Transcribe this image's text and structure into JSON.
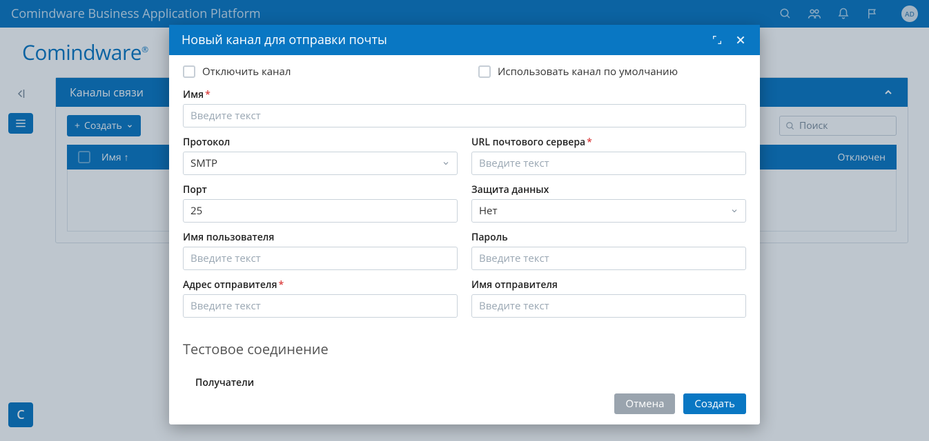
{
  "header": {
    "title": "Comindware Business Application Platform",
    "avatar": "AD"
  },
  "brand": "Comindware",
  "page": {
    "title": "Каналы связи",
    "create": "Создать",
    "search_placeholder": "Поиск",
    "cols": {
      "name": "Имя",
      "disabled": "Отключен"
    }
  },
  "modal": {
    "title": "Новый канал для отправки почты",
    "disable_channel": "Отключить канал",
    "use_default": "Использовать канал по умолчанию",
    "labels": {
      "name": "Имя",
      "protocol": "Протокол",
      "url": "URL почтового сервера",
      "port": "Порт",
      "protection": "Защита данных",
      "username": "Имя пользователя",
      "password": "Пароль",
      "from_addr": "Адрес отправителя",
      "from_name": "Имя отправителя",
      "recipients": "Получатели"
    },
    "values": {
      "protocol": "SMTP",
      "port": "25",
      "protection": "Нет"
    },
    "placeholder": "Введите текст",
    "section_test": "Тестовое соединение",
    "buttons": {
      "cancel": "Отмена",
      "create": "Создать"
    }
  }
}
